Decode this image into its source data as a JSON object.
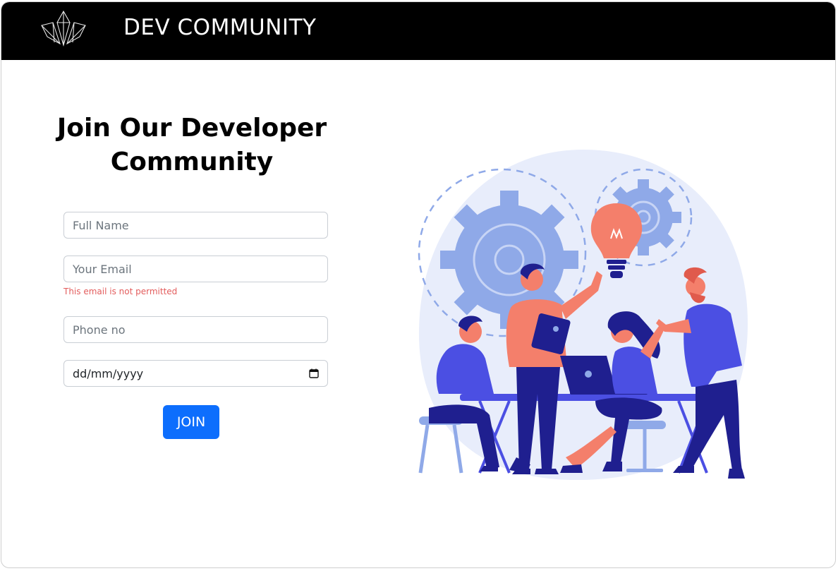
{
  "navbar": {
    "logo_icon": "crystal-logo-icon",
    "brand": "DEV COMMUNITY"
  },
  "signup": {
    "heading_line1": "Join Our Developer",
    "heading_line2": "Community",
    "fields": {
      "full_name_placeholder": "Full Name",
      "email_placeholder": "Your Email",
      "email_error": "This email is not permitted",
      "phone_placeholder": "Phone no",
      "date_value": "dd/mm/yyyy"
    },
    "join_label": "JOIN"
  },
  "illustration": {
    "icon": "team-collaboration-illustration"
  },
  "colors": {
    "navbar_bg": "#000000",
    "button_bg": "#0d6efd",
    "error_text": "#e35d5d",
    "illustration_blue": "#4b4fe3",
    "illustration_coral": "#f47f6b",
    "illustration_light": "#e8edfb"
  }
}
